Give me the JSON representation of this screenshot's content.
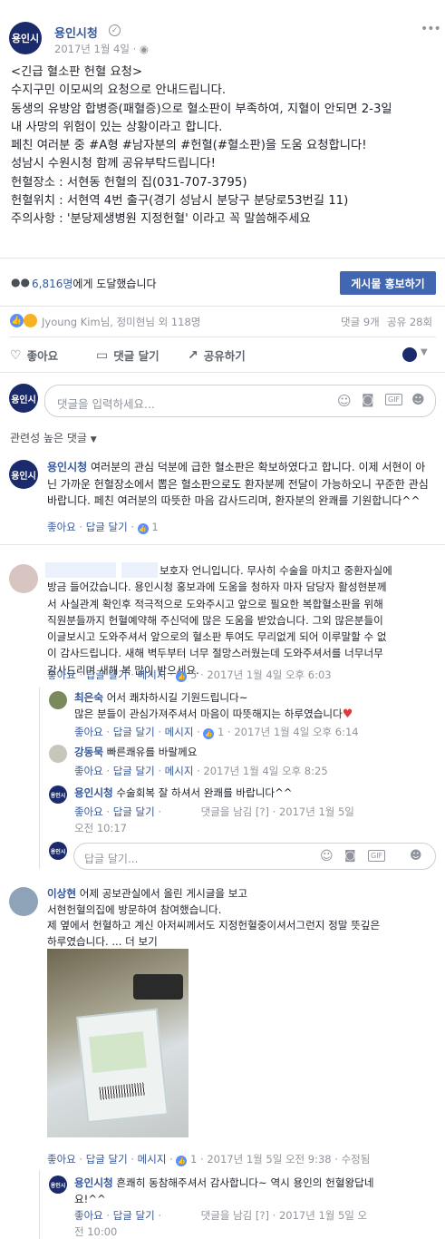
{
  "page": {
    "name": "용인시청",
    "avatar_text": "용인시",
    "date": "2017년 1월 4일"
  },
  "post": {
    "lines": [
      "<긴급 혈소판 헌혈 요청>",
      "수지구민 이모씨의 요청으로 안내드립니다.",
      "동생의 유방암 합병증(패혈증)으로 혈소판이 부족하여, 지혈이 안되면 2-3일",
      "내 사망의 위험이 있는 상황이라고 합니다.",
      "페친 여러분 중 #A형 #남자분의 #헌혈(#혈소판)을 도움 요청합니다!",
      "성남시 수원시청 함께 공유부탁드립니다!",
      "헌혈장소 : 서현동 헌혈의 집(031-707-3795)",
      "헌혈위치 : 서현역 4번 출구(경기 성남시 분당구 분당로53번길 11)",
      "주의사항 : '분당제생병원            지정헌혈' 이라고 꼭 말씀해주세요"
    ]
  },
  "reach": {
    "count": "6,816명",
    "suffix": "에게 도달했습니다",
    "boost_label": "게시물 홍보하기"
  },
  "reactions": {
    "names": "Jyoung Kim님, 정미현님 외 118명",
    "comments_count": "댓글 9개",
    "shares_count": "공유 28회"
  },
  "actions": {
    "like": "좋아요",
    "comment": "댓글 달기",
    "share": "공유하기"
  },
  "composer": {
    "placeholder": "댓글을 입력하세요..."
  },
  "sort_label": "관련성 높은 댓글",
  "comments": [
    {
      "author": "용인시청",
      "text": "여러분의 관심 덕분에 급한 혈소판은 확보하였다고 합니다. 이제 서현이 아닌 가까운 헌혈장소에서 뽑은 혈소판으로도 환자분께 전달이 가능하오니 꾸준한 관심 바랍니다. 페친 여러분의 따뜻한 마음 감사드리며, 환자분의 완쾌를 기원합니다^^",
      "like": "좋아요",
      "reply": "답글 달기",
      "reactions": "1"
    },
    {
      "author": "",
      "text_lines": [
        "보호자 언니입니다. 무사히 수술을 마치고 중환자실에",
        "방금 들어갔습니다. 용인시청 홍보과에 도움을 청하자 마자 담당자 활성현분께",
        "서 사실관계 확인후 적극적으로 도와주시고 앞으로 필요한 복합혈소판을 위해",
        "직원분들까지 헌혈예약해 주신덕에 많은 도움을 받았습니다. 그외 많은분들이",
        "이글보시고 도와주셔서 앞으로의 혈소판 투여도 무리없게 되어 이루말할 수 없",
        "이 감사드립니다. 새해 벽두부터 너무 절망스러웠는데 도와주셔서를 너무너무",
        "감사드리며 새해 복 많이 받으세요."
      ],
      "like": "좋아요",
      "reply": "답글 달기",
      "message": "메시지",
      "reactions": "5",
      "time": "2017년 1월 4일 오후 6:03",
      "replies": [
        {
          "author": "최은숙",
          "text_lines": [
            "어서 쾌차하시길 기원드립니다~",
            "많은 분들이 관심가져주셔서 마음이 따뜻해지는 하루였습니다"
          ],
          "heart": "♥",
          "like": "좋아요",
          "reply": "답글 달기",
          "message": "메시지",
          "reactions": "1",
          "time": "2017년 1월 4일 오후 6:14"
        },
        {
          "author": "강동묵",
          "text": "빠른쾌유를 바랄께요",
          "like": "좋아요",
          "reply": "답글 달기",
          "message": "메시지",
          "time": "2017년 1월 4일 오후 8:25"
        },
        {
          "author": "용인시청",
          "text": "수술회복 잘 하셔서 완쾌를 바랍니다^^",
          "like": "좋아요",
          "reply": "답글 달기",
          "status": "댓글을 남김 [?]",
          "time_1": "2017년 1월 5일",
          "time_2": "오전 10:17"
        }
      ],
      "reply_placeholder": "답글 달기..."
    },
    {
      "author": "이상현",
      "text_lines": [
        "어제 공보관실에서 올린 게시글을 보고",
        "서현헌혈의집에 방문하여 참여했습니다.",
        "제 옆에서 헌혈하고 계신 아저씨께서도 지정헌혈중이셔서그런지 정말 뜻깊은",
        "하루였습니다. ... 더 보기"
      ],
      "like": "좋아요",
      "reply": "답글 달기",
      "message": "메시지",
      "reactions": "1",
      "time": "2017년 1월 5일 오전 9:38",
      "edited": "수정됨",
      "replies": [
        {
          "author": "용인시청",
          "text_lines": [
            "흔쾌히 동참해주셔서 감사합니다~ 역시 용인의 헌혈왕답네",
            "요!^^"
          ],
          "like": "좋아요",
          "reply": "답글 달기",
          "status": "댓글을 남김 [?]",
          "time_1": "2017년 1월 5일 오",
          "time_2": "전 10:00"
        }
      ]
    }
  ],
  "icons": {
    "verified": "✓",
    "globe": "🌐",
    "more": "•••",
    "thumb": "👍",
    "chevron": "▾"
  }
}
